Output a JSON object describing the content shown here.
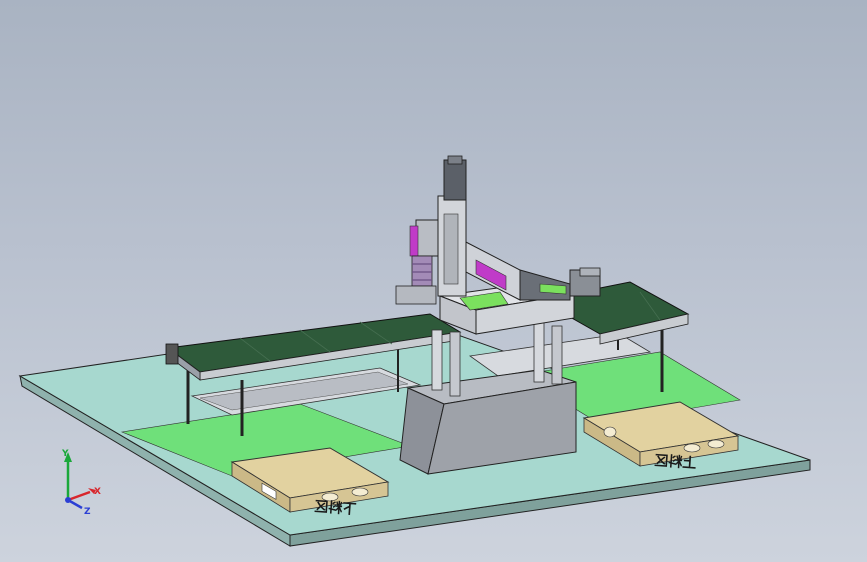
{
  "scene": {
    "description_labels": {
      "zone_left": "下料区",
      "zone_right": "上料区"
    },
    "triad": {
      "x_label": "X",
      "y_label": "Y",
      "z_label": "Z"
    }
  },
  "colors": {
    "floor": "#a7d8cf",
    "floor_zone": "#6fe07a",
    "belt": "#2e5a3a",
    "frame": "#c9ccd1",
    "pallet": "#e2d2a0",
    "base_block": "#9ea2a9",
    "accent_magenta": "#c03bc8",
    "accent_green": "#7be05e"
  }
}
